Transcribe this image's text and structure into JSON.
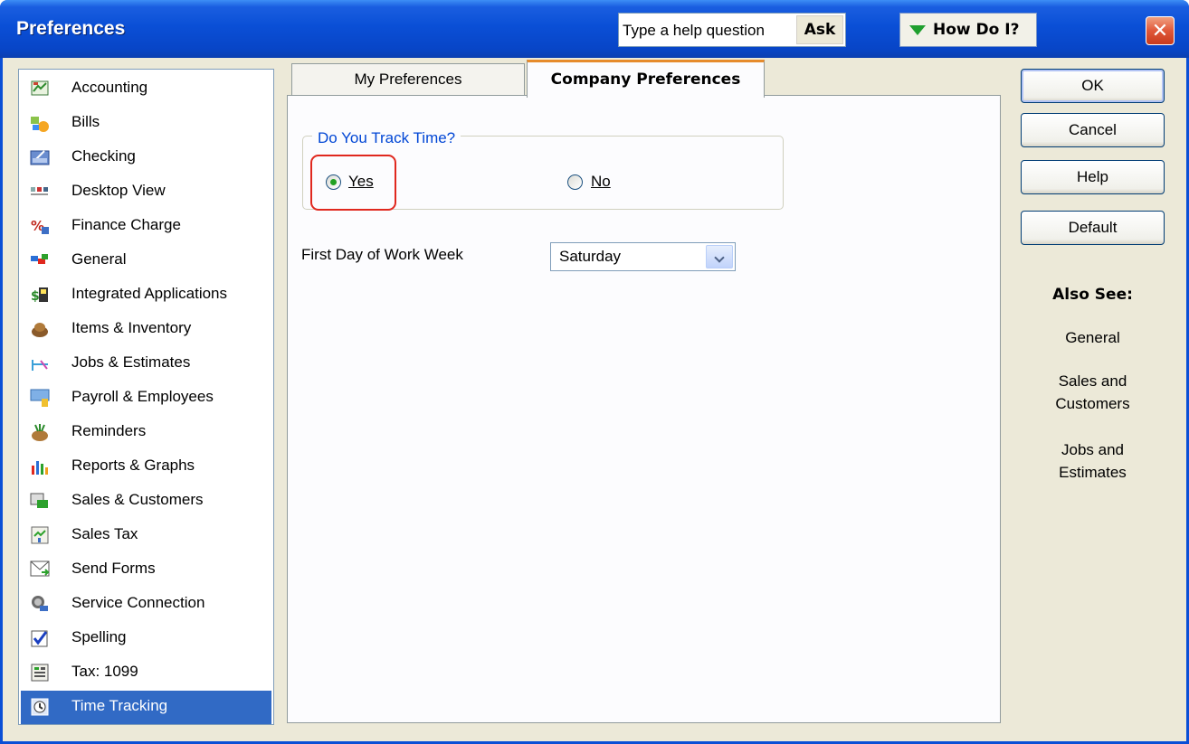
{
  "window": {
    "title": "Preferences",
    "help_placeholder": "Type a help question",
    "ask_label": "Ask",
    "howdoi_label": "How Do I?",
    "close_glyph": "✕"
  },
  "sidebar": {
    "items": [
      {
        "label": "Accounting",
        "icon": "accounting-icon"
      },
      {
        "label": "Bills",
        "icon": "bills-icon"
      },
      {
        "label": "Checking",
        "icon": "checking-icon"
      },
      {
        "label": "Desktop View",
        "icon": "desktop-view-icon"
      },
      {
        "label": "Finance Charge",
        "icon": "finance-charge-icon"
      },
      {
        "label": "General",
        "icon": "general-icon"
      },
      {
        "label": "Integrated Applications",
        "icon": "integrated-applications-icon"
      },
      {
        "label": "Items & Inventory",
        "icon": "items-inventory-icon"
      },
      {
        "label": "Jobs & Estimates",
        "icon": "jobs-estimates-icon"
      },
      {
        "label": "Payroll & Employees",
        "icon": "payroll-employees-icon"
      },
      {
        "label": "Reminders",
        "icon": "reminders-icon"
      },
      {
        "label": "Reports & Graphs",
        "icon": "reports-graphs-icon"
      },
      {
        "label": "Sales & Customers",
        "icon": "sales-customers-icon"
      },
      {
        "label": "Sales Tax",
        "icon": "sales-tax-icon"
      },
      {
        "label": "Send Forms",
        "icon": "send-forms-icon"
      },
      {
        "label": "Service Connection",
        "icon": "service-connection-icon"
      },
      {
        "label": "Spelling",
        "icon": "spelling-icon"
      },
      {
        "label": "Tax: 1099",
        "icon": "tax-1099-icon"
      },
      {
        "label": "Time Tracking",
        "icon": "time-tracking-icon",
        "selected": true
      }
    ]
  },
  "tabs": {
    "my": "My Preferences",
    "company": "Company Preferences",
    "active": "company"
  },
  "track_time": {
    "legend": "Do You Track Time?",
    "yes_label": "Yes",
    "no_label": "No",
    "selected": "yes"
  },
  "work_week": {
    "label": "First Day of Work Week",
    "value": "Saturday"
  },
  "buttons": {
    "ok": "OK",
    "cancel": "Cancel",
    "help": "Help",
    "default": "Default"
  },
  "also_see": {
    "title": "Also See:",
    "links": [
      "General",
      "Sales and\nCustomers",
      "Jobs and\nEstimates"
    ]
  },
  "colors": {
    "title_bar": "#0a4fd6",
    "selection": "#316ac5",
    "radio_selected": "#21a121",
    "highlight_ring": "#e0281e",
    "legend_text": "#0046d5"
  }
}
